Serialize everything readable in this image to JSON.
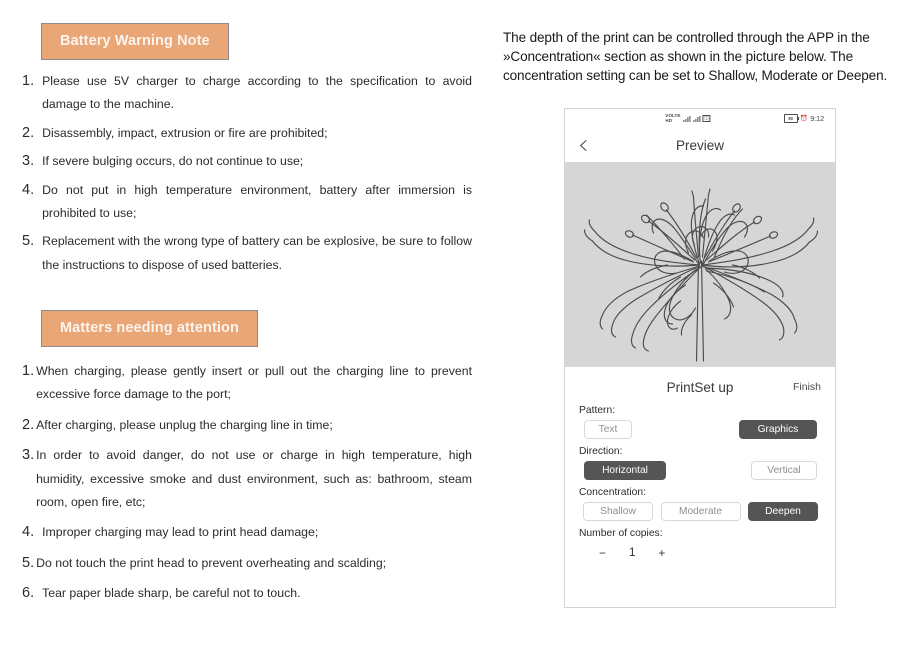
{
  "document": {
    "left_column": {
      "sections": [
        {
          "heading": "Battery Warning Note",
          "items": [
            {
              "num": "1.",
              "text": "Please use 5V charger to charge according to the specification to avoid damage to the machine."
            },
            {
              "num": "2.",
              "text": "Disassembly, impact, extrusion or fire are prohibited;"
            },
            {
              "num": "3.",
              "text": "If severe bulging occurs, do not continue to use;"
            },
            {
              "num": "4.",
              "text": "Do not put in high temperature environment, battery after immersion is prohibited to use;"
            },
            {
              "num": "5.",
              "text": "Replacement with the wrong type of battery can be explosive, be sure to follow the instructions to dispose of used batteries."
            }
          ]
        },
        {
          "heading": "Matters needing attention",
          "items": [
            {
              "num": "1.",
              "text": "When charging, please gently insert or pull out the charging line to prevent excessive force damage to the port;"
            },
            {
              "num": "2.",
              "text": "After charging, please unplug the charging line in time;"
            },
            {
              "num": "3.",
              "text": "In order to avoid danger, do not use or charge in high temperature, high humidity, excessive smoke and dust environment, such as: bathroom, steam room, open fire, etc;"
            },
            {
              "num": "4.",
              "text": "Improper charging may lead to print head damage;"
            },
            {
              "num": "5.",
              "text": "Do not touch the print head to prevent overheating and scalding;"
            },
            {
              "num": "6.",
              "text": "Tear paper blade sharp, be careful not to touch."
            }
          ]
        }
      ]
    },
    "right_column": {
      "intro_paragraph": "The depth of the print can be controlled through the APP in the »Concentration« section as shown in the picture below. The concentration setting can be set to Shallow, Moderate or Deepen."
    }
  },
  "phone": {
    "status_bar": {
      "carrier_stack_top": "VOLTE",
      "carrier_stack_bottom": "HD",
      "sim_box_glyph": "◫",
      "battery_level_label": "80",
      "alarm_glyph": "⏰",
      "time": "9:12"
    },
    "navbar": {
      "back_icon": "chevron-left-icon",
      "title": "Preview"
    },
    "preview": {
      "image_alt": "spider-lily-line-art"
    },
    "settings": {
      "title": "PrintSet up",
      "finish_label": "Finish",
      "pattern": {
        "label": "Pattern:",
        "options": [
          {
            "label": "Text",
            "selected": false
          },
          {
            "label": "Graphics",
            "selected": true
          }
        ]
      },
      "direction": {
        "label": "Direction:",
        "options": [
          {
            "label": "Horizontal",
            "selected": true
          },
          {
            "label": "Vertical",
            "selected": false
          }
        ]
      },
      "concentration": {
        "label": "Concentration:",
        "options": [
          {
            "label": "Shallow",
            "selected": false
          },
          {
            "label": "Moderate",
            "selected": false
          },
          {
            "label": "Deepen",
            "selected": true
          }
        ]
      },
      "copies": {
        "label": "Number of copies:",
        "decrement": "−",
        "value": "1",
        "increment": "+"
      }
    }
  },
  "colors": {
    "heading_orange": "#e9a677",
    "heading_border": "#8c8c8c",
    "heading_text": "#fdf4ee",
    "selected_button": "#555555",
    "preview_bg": "#d6d6d6",
    "phone_border": "#d3d3d3"
  }
}
